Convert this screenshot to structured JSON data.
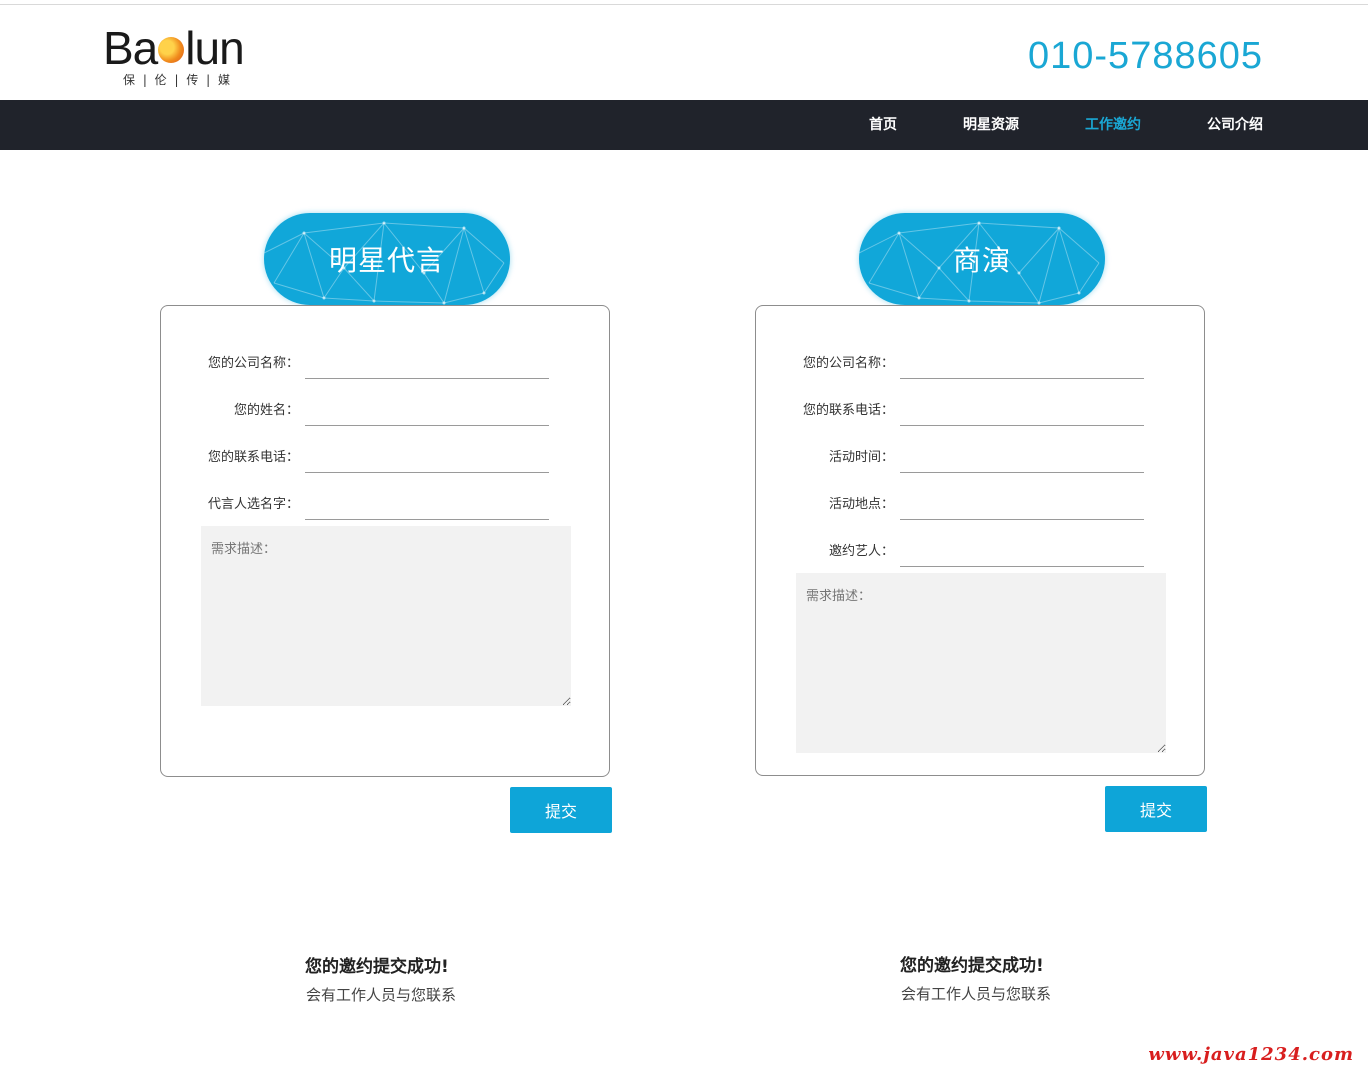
{
  "header": {
    "logo_word_left": "Ba",
    "logo_word_right": "lun",
    "logo_sub": "保 | 伦 | 传 | 媒",
    "phone": "010-5788605"
  },
  "nav": {
    "items": [
      {
        "label": "首页"
      },
      {
        "label": "明星资源"
      },
      {
        "label": "工作邀约"
      },
      {
        "label": "公司介绍"
      }
    ],
    "active_index": 2
  },
  "forms": [
    {
      "title": "明星代言",
      "fields": [
        {
          "label": "您的公司名称：",
          "value": ""
        },
        {
          "label": "您的姓名：",
          "value": ""
        },
        {
          "label": "您的联系电话：",
          "value": ""
        },
        {
          "label": "代言人选名字：",
          "value": ""
        }
      ],
      "description_placeholder": "需求描述：",
      "submit_label": "提交",
      "success_title": "您的邀约提交成功!",
      "success_sub": "会有工作人员与您联系"
    },
    {
      "title": "商演",
      "fields": [
        {
          "label": "您的公司名称：",
          "value": ""
        },
        {
          "label": "您的联系电话：",
          "value": ""
        },
        {
          "label": "活动时间：",
          "value": ""
        },
        {
          "label": "活动地点：",
          "value": ""
        },
        {
          "label": "邀约艺人：",
          "value": ""
        }
      ],
      "description_placeholder": "需求描述：",
      "submit_label": "提交",
      "success_title": "您的邀约提交成功!",
      "success_sub": "会有工作人员与您联系"
    }
  ],
  "watermark": "www.java1234.com",
  "colors": {
    "accent": "#1aa7d4",
    "nav_bg": "#20232b",
    "button": "#0ea5d8"
  }
}
